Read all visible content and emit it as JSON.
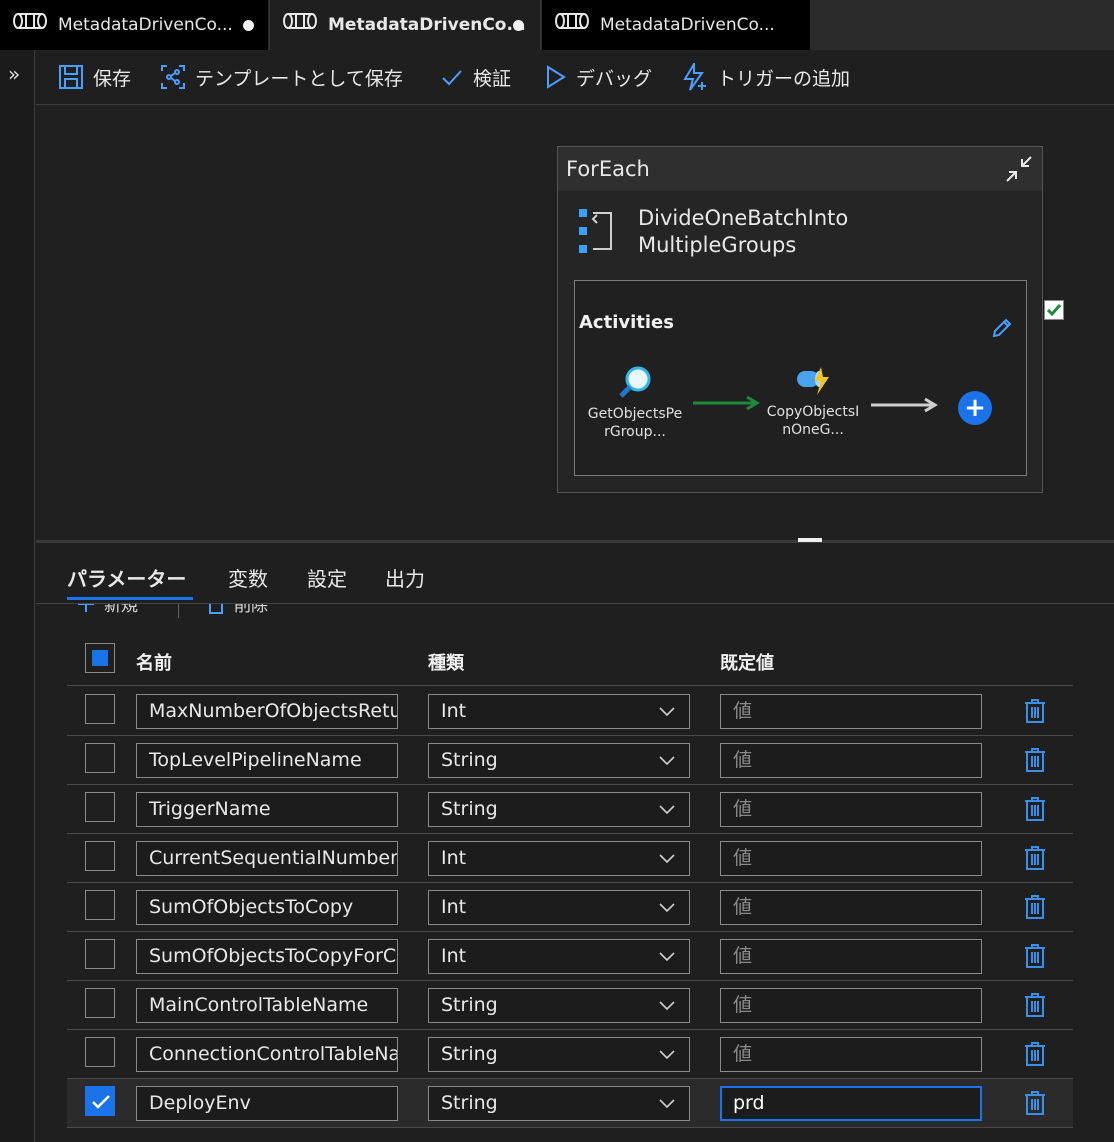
{
  "tabs": [
    {
      "label": "MetadataDrivenCo...",
      "unsaved": true
    },
    {
      "label": "MetadataDrivenCo...",
      "unsaved": true,
      "active": true
    },
    {
      "label": "MetadataDrivenCo...",
      "unsaved": false
    }
  ],
  "toolbar": {
    "save_label": "保存",
    "save_template_label": "テンプレートとして保存",
    "validate_label": "検証",
    "debug_label": "デバッグ",
    "add_trigger_label": "トリガーの追加"
  },
  "canvas": {
    "foreach": {
      "type_label": "ForEach",
      "activity_name": "DivideOneBatchIntoMultipleGroups",
      "activities_label": "Activities",
      "nodes": [
        {
          "label": "GetObjectsPerGroup..."
        },
        {
          "label": "CopyObjectsInOneG..."
        }
      ],
      "status_checked": true
    }
  },
  "panel": {
    "tabs": [
      "パラメーター",
      "変数",
      "設定",
      "出力"
    ],
    "active_tab": "パラメーター",
    "actions": {
      "new_label": "新規",
      "delete_label": "削除"
    },
    "columns": {
      "name": "名前",
      "type": "種類",
      "default": "既定値"
    },
    "default_placeholder": "値",
    "rows": [
      {
        "name": "MaxNumberOfObjectsReturnedFromLookupActivity",
        "type": "Int",
        "default": "",
        "checked": false
      },
      {
        "name": "TopLevelPipelineName",
        "type": "String",
        "default": "",
        "checked": false
      },
      {
        "name": "TriggerName",
        "type": "String",
        "default": "",
        "checked": false
      },
      {
        "name": "CurrentSequentialNumberOfBatch",
        "type": "Int",
        "default": "",
        "checked": false
      },
      {
        "name": "SumOfObjectsToCopy",
        "type": "Int",
        "default": "",
        "checked": false
      },
      {
        "name": "SumOfObjectsToCopyForCurrentBatch",
        "type": "Int",
        "default": "",
        "checked": false
      },
      {
        "name": "MainControlTableName",
        "type": "String",
        "default": "",
        "checked": false
      },
      {
        "name": "ConnectionControlTableName",
        "type": "String",
        "default": "",
        "checked": false
      },
      {
        "name": "DeployEnv",
        "type": "String",
        "default": "prd",
        "checked": true
      }
    ]
  },
  "colors": {
    "accent": "#1a73e8",
    "background": "#1f1f1f",
    "success": "#1e8a3a"
  }
}
